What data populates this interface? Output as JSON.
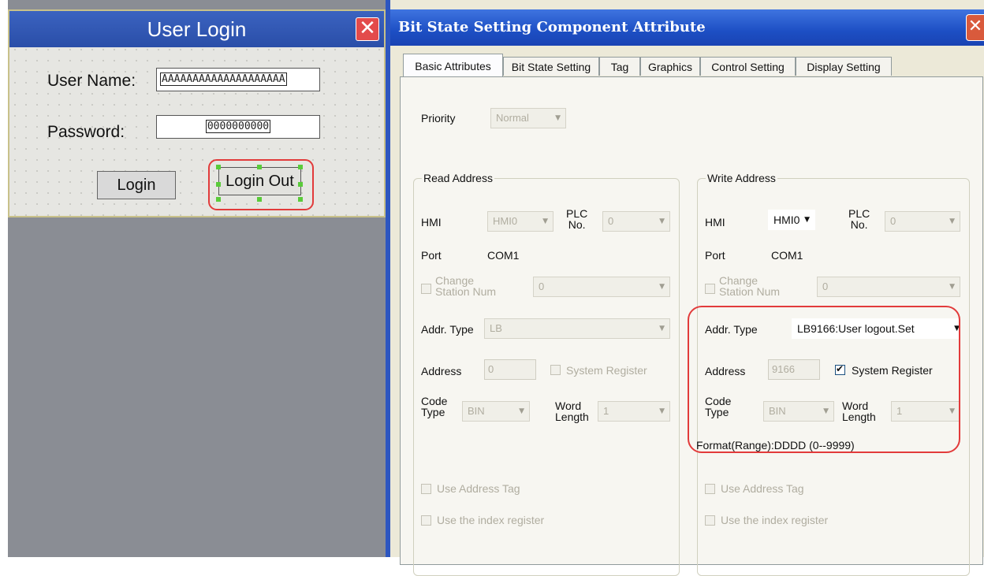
{
  "login": {
    "title": "User Login",
    "close_glyph": "✕",
    "user_name_label": "User Name:",
    "user_name_value": "AAAAAAAAAAAAAAAAAAAA",
    "password_label": "Password:",
    "password_value": "0000000000",
    "login_button": "Login",
    "logout_button": "Login Out"
  },
  "dialog": {
    "title": "Bit State Setting Component Attribute",
    "close_glyph": "✕",
    "tabs": [
      "Basic Attributes",
      "Bit State Setting",
      "Tag",
      "Graphics",
      "Control Setting",
      "Display Setting"
    ],
    "priority": {
      "label": "Priority",
      "value": "Normal"
    },
    "read": {
      "title": "Read Address",
      "hmi_label": "HMI",
      "hmi_value": "HMI0",
      "plc_label_1": "PLC",
      "plc_label_2": "No.",
      "plc_value": "0",
      "port_label": "Port",
      "port_value": "COM1",
      "change_station_1": "Change",
      "change_station_2": "Station Num",
      "station_value": "0",
      "addr_type_label": "Addr. Type",
      "addr_type_value": "LB",
      "address_label": "Address",
      "address_value": "0",
      "system_register_label": "System Register",
      "system_register_checked": false,
      "code_type_1": "Code",
      "code_type_2": "Type",
      "code_type_value": "BIN",
      "word_length_1": "Word",
      "word_length_2": "Length",
      "word_length_value": "1",
      "use_address_tag": "Use Address Tag",
      "use_index_register": "Use the index register"
    },
    "write": {
      "title": "Write Address",
      "hmi_label": "HMI",
      "hmi_value": "HMI0",
      "plc_label_1": "PLC",
      "plc_label_2": "No.",
      "plc_value": "0",
      "port_label": "Port",
      "port_value": "COM1",
      "change_station_1": "Change",
      "change_station_2": "Station Num",
      "station_value": "0",
      "addr_type_label": "Addr. Type",
      "addr_type_value": "LB9166:User logout.Set",
      "address_label": "Address",
      "address_value": "9166",
      "system_register_label": "System Register",
      "system_register_checked": true,
      "code_type_1": "Code",
      "code_type_2": "Type",
      "code_type_value": "BIN",
      "word_length_1": "Word",
      "word_length_2": "Length",
      "word_length_value": "1",
      "format_range": "Format(Range):DDDD (0--9999)",
      "use_address_tag": "Use Address Tag",
      "use_index_register": "Use the index register"
    },
    "dropdown_arrow": "▼"
  },
  "colors": {
    "highlight": "#e23b3b",
    "dialog_title": "#1d4fc4",
    "login_title": "#2a4ea8",
    "handles": "#5acb3a"
  }
}
